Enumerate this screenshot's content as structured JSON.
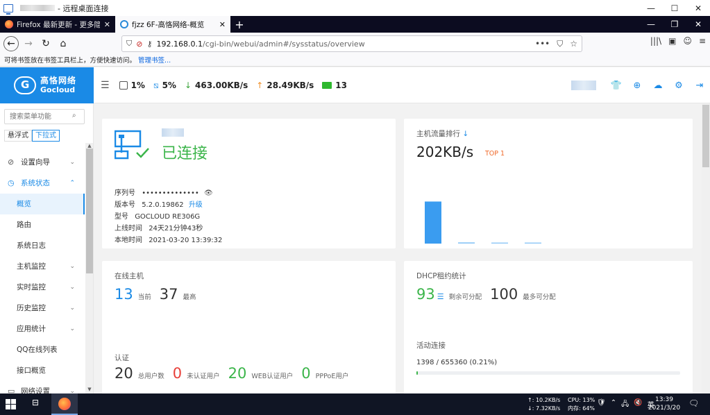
{
  "rdp": {
    "title": "- 远程桌面连接",
    "controls": [
      "—",
      "☐",
      "✕"
    ]
  },
  "browser": {
    "tabs": [
      {
        "label": "Firefox 最新更新 - 更多隐私...",
        "close": "✕"
      },
      {
        "label": "fjzz 6F-高恪网络-概览",
        "close": "✕"
      }
    ],
    "new_tab": "+",
    "window_controls": [
      "—",
      "❐",
      "✕"
    ],
    "nav": {
      "back": "←",
      "forward": "→",
      "reload": "↻",
      "home": "⌂"
    },
    "url": {
      "host": "192.168.0.1",
      "path": "/cgi-bin/webui/admin#/sysstatus/overview",
      "more": "•••",
      "pocket": "⛉",
      "star": "☆"
    },
    "right_icons": [
      "|||\\",
      "▣",
      "☺",
      "≡"
    ],
    "bookmarks_bar": {
      "text": "可将书签放在书签工具栏上，方便快速访问。",
      "link": "管理书签..."
    }
  },
  "header": {
    "logo_cn": "高恪网络",
    "logo_en": "Gocloud",
    "menu_icon": "☰",
    "cpu": "1%",
    "mem": "5%",
    "down": "463.00KB/s",
    "up": "28.49KB/s",
    "hosts": "13",
    "icons": [
      "shirt-icon",
      "globe-icon",
      "cloud-upload-icon",
      "gear-icon",
      "logout-icon"
    ],
    "icon_glyphs": [
      "👕",
      "⊕",
      "☁",
      "⚙",
      "⇥"
    ]
  },
  "sidebar": {
    "search_placeholder": "搜索菜单功能",
    "search_icon": "⌕",
    "modes": [
      "悬浮式",
      "下拉式"
    ],
    "items": [
      {
        "label": "设置向导",
        "icon": "⊘",
        "chev": "⌄"
      },
      {
        "label": "系统状态",
        "icon": "◷",
        "chev": "⌃"
      },
      {
        "label": "概览"
      },
      {
        "label": "路由"
      },
      {
        "label": "系统日志"
      },
      {
        "label": "主机监控",
        "chev": "⌄"
      },
      {
        "label": "实时监控",
        "chev": "⌄"
      },
      {
        "label": "历史监控",
        "chev": "⌄"
      },
      {
        "label": "应用统计",
        "chev": "⌄"
      },
      {
        "label": "QQ在线列表"
      },
      {
        "label": "接口概览"
      },
      {
        "label": "网络设置",
        "icon": "▭",
        "chev": "⌄"
      }
    ]
  },
  "device": {
    "status": "已连接",
    "serial_label": "序列号",
    "serial": "••••••••••••••",
    "eye": "👁",
    "version_label": "版本号",
    "version": "5.2.0.19862",
    "upgrade": "升级",
    "model_label": "型号",
    "model": "GOCLOUD RE306G",
    "uptime_label": "上线时间",
    "uptime": "24天21分钟43秒",
    "localtime_label": "本地时间",
    "localtime": "2021-03-20 13:39:32"
  },
  "flow": {
    "title": "主机流量排行",
    "sort_icon": "↓",
    "value": "202KB/s",
    "tag": "TOP 1"
  },
  "chart_data": {
    "type": "bar",
    "categories": [
      "",
      "",
      "",
      ""
    ],
    "values": [
      202,
      6,
      5,
      3
    ],
    "ylim": [
      0,
      260
    ],
    "color": "#3a9cf0",
    "grid": false
  },
  "hosts": {
    "title": "在线主机",
    "current": "13",
    "current_label": "当前",
    "max": "37",
    "max_label": "最高",
    "auth_title": "认证",
    "total_users": "20",
    "total_label": "总用户数",
    "unauth": "0",
    "unauth_label": "未认证用户",
    "web_auth": "20",
    "web_label": "WEB认证用户",
    "pppoe": "0",
    "pppoe_label": "PPPoE用户"
  },
  "dhcp": {
    "title": "DHCP租约统计",
    "remain": "93",
    "list_icon": "☰",
    "remain_label": "剩余可分配",
    "max": "100",
    "max_label": "最多可分配",
    "conn_title": "活动连接",
    "conn_value": "1398 / 655360 (0.21%)",
    "conn_percent": 0.21
  },
  "taskbar": {
    "task_icon": "⊟",
    "net_up": "↑: 10.2KB/s",
    "net_down": "↓: 7.32KB/s",
    "cpu": "CPU: 13%",
    "mem": "内存: 64%",
    "ime": "英",
    "time": "13:39",
    "date": "2021/3/20",
    "notif_icon": "🗨"
  }
}
